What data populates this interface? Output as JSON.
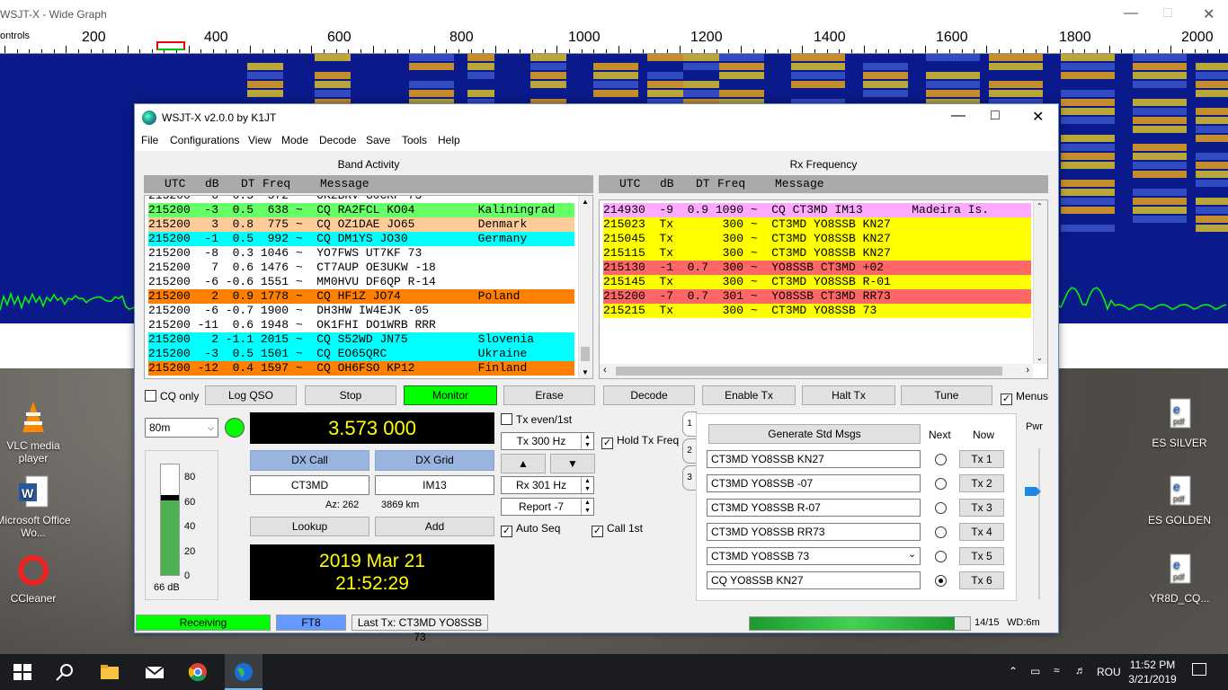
{
  "wide_graph": {
    "title": "WSJT-X - Wide Graph",
    "controls_label": "ontrols",
    "scale": [
      "200",
      "400",
      "600",
      "800",
      "1000",
      "1200",
      "1400",
      "1600",
      "1800",
      "2000"
    ]
  },
  "desktop_icons": [
    {
      "label": "VLC media player"
    },
    {
      "label": "Microsoft Office Wo..."
    },
    {
      "label": "CCleaner"
    },
    {
      "label": "ES SILVER"
    },
    {
      "label": "ES GOLDEN"
    },
    {
      "label": "YR8D_CQ..."
    }
  ],
  "main": {
    "title": "WSJT-X   v2.0.0   by K1JT",
    "menu": [
      "File",
      "Configurations",
      "View",
      "Mode",
      "Decode",
      "Save",
      "Tools",
      "Help"
    ],
    "band_activity": {
      "title": "Band Activity",
      "headers": [
        "UTC",
        "dB",
        "DT",
        "Freq",
        "Message"
      ],
      "partial_row": "215200   6  0.5  572 ~  OK2BRV G0CRP 73",
      "rows": [
        {
          "text": "215200  -3  0.5  638 ~  CQ RA2FCL KO04         Kaliningrad",
          "bg": "#66ff66"
        },
        {
          "text": "215200   3  0.8  775 ~  CQ OZ1DAE JO65         Denmark",
          "bg": "#ffcc99"
        },
        {
          "text": "215200  -1  0.5  992 ~  CQ DM1YS JO30          Germany",
          "bg": "#00ffff"
        },
        {
          "text": "215200  -8  0.3 1046 ~  YO7FWS UT7KF 73",
          "bg": "#ffffff"
        },
        {
          "text": "215200   7  0.6 1476 ~  CT7AUP OE3UKW -18",
          "bg": "#ffffff"
        },
        {
          "text": "215200  -6 -0.6 1551 ~  MM0HVU DF6QP R-14",
          "bg": "#ffffff"
        },
        {
          "text": "215200   2  0.9 1778 ~  CQ HF1Z JO74           Poland",
          "bg": "#ff8000"
        },
        {
          "text": "215200  -6 -0.7 1900 ~  DH3HW IW4EJK -05",
          "bg": "#ffffff"
        },
        {
          "text": "215200 -11  0.6 1948 ~  OK1FHI DO1WRB RRR",
          "bg": "#ffffff"
        },
        {
          "text": "215200   2 -1.1 2015 ~  CQ S52WD JN75          Slovenia",
          "bg": "#00ffff"
        },
        {
          "text": "215200  -3  0.5 1501 ~  CQ EO65QRC             Ukraine",
          "bg": "#00ffff"
        },
        {
          "text": "215200 -12  0.4 1597 ~  CQ OH6FSO KP12         Finland",
          "bg": "#ff8000"
        }
      ]
    },
    "rx_frequency": {
      "title": "Rx Frequency",
      "headers": [
        "UTC",
        "dB",
        "DT",
        "Freq",
        "Message"
      ],
      "rows": [
        {
          "text": "214930  -9  0.9 1090 ~  CQ CT3MD IM13       Madeira Is.",
          "bg": "#ffaaff"
        },
        {
          "text": "215023  Tx       300 ~  CT3MD YO8SSB KN27",
          "bg": "#ffff00"
        },
        {
          "text": "215045  Tx       300 ~  CT3MD YO8SSB KN27",
          "bg": "#ffff00"
        },
        {
          "text": "215115  Tx       300 ~  CT3MD YO8SSB KN27",
          "bg": "#ffff00"
        },
        {
          "text": "215130  -1  0.7  300 ~  YO8SSB CT3MD +02",
          "bg": "#ff6666"
        },
        {
          "text": "215145  Tx       300 ~  CT3MD YO8SSB R-01",
          "bg": "#ffff00"
        },
        {
          "text": "215200  -7  0.7  301 ~  YO8SSB CT3MD RR73",
          "bg": "#ff6666"
        },
        {
          "text": "215215  Tx       300 ~  CT3MD YO8SSB 73",
          "bg": "#ffff00"
        }
      ]
    },
    "buttons": {
      "cq_only": "CQ only",
      "log_qso": "Log QSO",
      "stop": "Stop",
      "monitor": "Monitor",
      "erase": "Erase",
      "decode": "Decode",
      "enable_tx": "Enable Tx",
      "halt_tx": "Halt Tx",
      "tune": "Tune",
      "menus": "Menus"
    },
    "band": "80m",
    "frequency": "3.573 000",
    "dx_call_label": "DX Call",
    "dx_grid_label": "DX Grid",
    "dx_call": "CT3MD",
    "dx_grid": "IM13",
    "az": "Az: 262",
    "distance": "3869 km",
    "lookup": "Lookup",
    "add": "Add",
    "date": "2019 Mar 21",
    "time": "21:52:29",
    "meter_ticks": [
      "80",
      "60",
      "40",
      "20",
      "0"
    ],
    "meter_level_db": 66,
    "meter_label": "66 dB",
    "tx_even": "Tx even/1st",
    "tx_freq": "Tx  300  Hz",
    "hold_tx_freq": "Hold Tx Freq",
    "rx_freq": "Rx  301  Hz",
    "report": "Report  -7",
    "auto_seq": "Auto Seq",
    "call_1st": "Call 1st",
    "tabs": [
      "1",
      "2",
      "3"
    ],
    "generate_std_msgs": "Generate Std Msgs",
    "next_label": "Next",
    "now_label": "Now",
    "pwr_label": "Pwr",
    "tx_messages": [
      {
        "msg": "CT3MD YO8SSB KN27",
        "btn": "Tx 1"
      },
      {
        "msg": "CT3MD YO8SSB -07",
        "btn": "Tx 2"
      },
      {
        "msg": "CT3MD YO8SSB R-07",
        "btn": "Tx 3"
      },
      {
        "msg": "CT3MD YO8SSB RR73",
        "btn": "Tx 4"
      },
      {
        "msg": "CT3MD YO8SSB 73",
        "btn": "Tx 5"
      },
      {
        "msg": "CQ YO8SSB KN27",
        "btn": "Tx 6"
      }
    ],
    "status": {
      "receiving": "Receiving",
      "mode": "FT8",
      "last_tx": "Last Tx: CT3MD YO8SSB 73",
      "progress_fraction": 0.93,
      "progress_text": "14/15",
      "wd": "WD:6m"
    }
  },
  "taskbar": {
    "language": "ROU",
    "time": "11:52 PM",
    "date": "3/21/2019"
  },
  "colors": {
    "monitor_green": "#00ff00",
    "status_green": "#00ff00",
    "status_blue": "#6699ff",
    "date_yellow": "#ffff00",
    "freq_yellow": "#ffff00"
  }
}
